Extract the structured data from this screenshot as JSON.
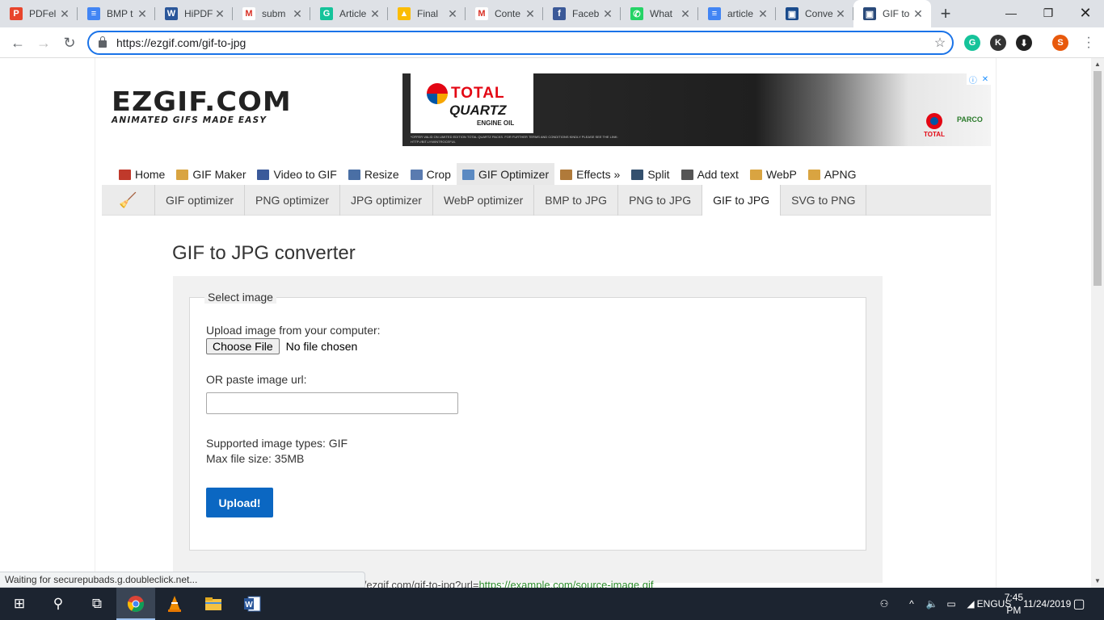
{
  "browser": {
    "tabs": [
      {
        "title": "PDFel",
        "color": "#e8452c",
        "glyph": "P"
      },
      {
        "title": "BMP t",
        "color": "#4285f4",
        "glyph": "≡"
      },
      {
        "title": "HiPDF",
        "color": "#2b579a",
        "glyph": "W"
      },
      {
        "title": "subm",
        "color": "#ffffff",
        "glyph": "M"
      },
      {
        "title": "Article",
        "color": "#15c39a",
        "glyph": "G"
      },
      {
        "title": "Final",
        "color": "#fbbc04",
        "glyph": "▲"
      },
      {
        "title": "Conte",
        "color": "#ffffff",
        "glyph": "M"
      },
      {
        "title": "Faceb",
        "color": "#3b5998",
        "glyph": "f"
      },
      {
        "title": "What",
        "color": "#25d366",
        "glyph": "✆"
      },
      {
        "title": "article",
        "color": "#4285f4",
        "glyph": "≡"
      },
      {
        "title": "Conve",
        "color": "#1a4b8c",
        "glyph": "▣"
      },
      {
        "title": "GIF to",
        "color": "#2a4a7a",
        "glyph": "▣"
      }
    ],
    "url": "https://ezgif.com/gif-to-jpg",
    "profile_initial": "S",
    "extensions": [
      "G",
      "K",
      "⬇"
    ]
  },
  "site": {
    "logo_main": "EZGIF.COM",
    "logo_sub": "ANIMATED GIFS MADE EASY",
    "ad": {
      "brand": "TOTAL",
      "product": "QUARTZ",
      "sub": "ENGINE OIL",
      "fine": "*OFFER VALID ON LIMITED EDITION TOTAL QUARTZ PACKS. FOR FURTHER TERMS AND CONDITIONS KINDLY PLEASE SEE THE LINK: HTTP://BIT.LY/WINTROCEFUL",
      "partner1": "TOTAL",
      "partner2": "PARCO"
    },
    "main_nav": [
      {
        "label": "Home",
        "icon": "home-icon",
        "color": "#c0392b"
      },
      {
        "label": "GIF Maker",
        "icon": "gif-maker-icon",
        "color": "#d9a441"
      },
      {
        "label": "Video to GIF",
        "icon": "film-icon",
        "color": "#3b5a9a"
      },
      {
        "label": "Resize",
        "icon": "resize-icon",
        "color": "#4a6fa5"
      },
      {
        "label": "Crop",
        "icon": "crop-icon",
        "color": "#5a7bb0"
      },
      {
        "label": "GIF Optimizer",
        "icon": "optimizer-icon",
        "color": "#5b8ac2"
      },
      {
        "label": "Effects »",
        "icon": "effects-icon",
        "color": "#b07a3a"
      },
      {
        "label": "Split",
        "icon": "split-icon",
        "color": "#34506e"
      },
      {
        "label": "Add text",
        "icon": "add-text-icon",
        "color": "#555555"
      },
      {
        "label": "WebP",
        "icon": "webp-icon",
        "color": "#d9a441"
      },
      {
        "label": "APNG",
        "icon": "apng-icon",
        "color": "#d9a441"
      }
    ],
    "sub_nav": [
      "GIF optimizer",
      "PNG optimizer",
      "JPG optimizer",
      "WebP optimizer",
      "BMP to JPG",
      "PNG to JPG",
      "GIF to JPG",
      "SVG to PNG"
    ],
    "page_title": "GIF to JPG converter",
    "form": {
      "legend": "Select image",
      "upload_label": "Upload image from your computer:",
      "choose_file": "Choose File",
      "no_file": "No file chosen",
      "url_label": "OR paste image url:",
      "url_value": "",
      "supported": "Supported image types: GIF",
      "max_size": "Max file size: 35MB",
      "upload_button": "Upload!"
    },
    "hint_prefix": "you can use: https://ezgif.com/gif-to-jpg?url=",
    "hint_link": "https://example.com/source-image.gif"
  },
  "status_text": "Waiting for securepubads.g.doubleclick.net...",
  "taskbar": {
    "lang_top": "ENG",
    "lang_bottom": "US",
    "time": "7:45 PM",
    "date": "11/24/2019"
  }
}
